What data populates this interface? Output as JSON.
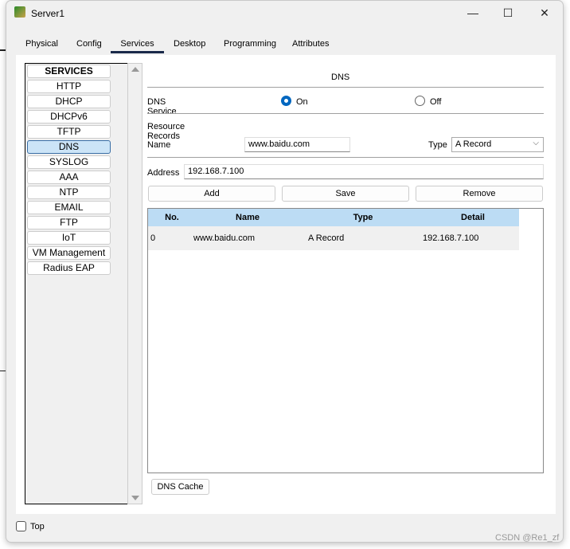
{
  "window": {
    "title": "Server1"
  },
  "tabs": [
    "Physical",
    "Config",
    "Services",
    "Desktop",
    "Programming",
    "Attributes"
  ],
  "active_tab": "Services",
  "services": [
    "SERVICES",
    "HTTP",
    "DHCP",
    "DHCPv6",
    "TFTP",
    "DNS",
    "SYSLOG",
    "AAA",
    "NTP",
    "EMAIL",
    "FTP",
    "IoT",
    "VM Management",
    "Radius EAP"
  ],
  "selected_service": "DNS",
  "dns": {
    "heading": "DNS",
    "service_label": "DNS Service",
    "on_label": "On",
    "off_label": "Off",
    "service_state": "On",
    "rr_label": "Resource Records",
    "name_label": "Name",
    "name_value": "www.baidu.com",
    "type_label": "Type",
    "type_value": "A Record",
    "address_label": "Address",
    "address_value": "192.168.7.100",
    "add": "Add",
    "save": "Save",
    "remove": "Remove",
    "columns": [
      "No.",
      "Name",
      "Type",
      "Detail"
    ],
    "rows": [
      [
        "0",
        "www.baidu.com",
        "A Record",
        "192.168.7.100"
      ]
    ],
    "cache": "DNS Cache"
  },
  "top_label": "Top",
  "watermark": "CSDN @Re1_zf",
  "colors": {
    "accent": "#0067c0",
    "header": "#bcdcf4",
    "selected": "#cce4f7"
  }
}
